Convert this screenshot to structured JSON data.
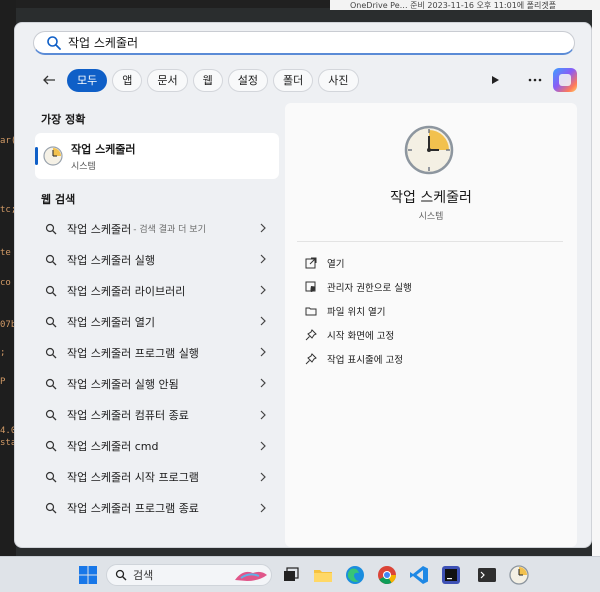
{
  "background": {
    "code_fragments": [
      "ar(",
      "tc;",
      "te",
      "co",
      "07b",
      ";",
      "P",
      "4.0",
      "sta"
    ],
    "top_right_text": "OneDrive Pe…  준비   2023-11-16 오후 11:01에   폴리겟플"
  },
  "search": {
    "query": "작업 스케줄러"
  },
  "filters": {
    "chips": [
      {
        "label": "모두",
        "active": true
      },
      {
        "label": "앱",
        "active": false
      },
      {
        "label": "문서",
        "active": false
      },
      {
        "label": "웹",
        "active": false
      },
      {
        "label": "설정",
        "active": false
      },
      {
        "label": "폴더",
        "active": false
      },
      {
        "label": "사진",
        "active": false
      }
    ]
  },
  "best_match": {
    "section_label": "가장 정확",
    "name": "작업 스케줄러",
    "type": "시스템"
  },
  "web": {
    "section_label": "웹 검색",
    "items": [
      {
        "text": "작업 스케줄러",
        "suffix": "- 검색 결과 더 보기"
      },
      {
        "text": "작업 스케줄러 실행",
        "suffix": ""
      },
      {
        "text": "작업 스케줄러 라이브러리",
        "suffix": ""
      },
      {
        "text": "작업 스케줄러 열기",
        "suffix": ""
      },
      {
        "text": "작업 스케줄러 프로그램 실행",
        "suffix": ""
      },
      {
        "text": "작업 스케줄러 실행 안됨",
        "suffix": ""
      },
      {
        "text": "작업 스케줄러 컴퓨터 종료",
        "suffix": ""
      },
      {
        "text": "작업 스케줄러 cmd",
        "suffix": ""
      },
      {
        "text": "작업 스케줄러 시작 프로그램",
        "suffix": ""
      },
      {
        "text": "작업 스케줄러 프로그램 종료",
        "suffix": ""
      }
    ]
  },
  "details": {
    "name": "작업 스케줄러",
    "type": "시스템",
    "actions": [
      {
        "label": "열기",
        "icon": "open-icon"
      },
      {
        "label": "관리자 권한으로 실행",
        "icon": "shield-icon"
      },
      {
        "label": "파일 위치 열기",
        "icon": "folder-icon"
      },
      {
        "label": "시작 화면에 고정",
        "icon": "pin-icon"
      },
      {
        "label": "작업 표시줄에 고정",
        "icon": "pin-icon"
      }
    ]
  },
  "taskbar": {
    "search_placeholder": "검색",
    "apps": [
      "task-view-icon",
      "file-explorer-icon",
      "edge-icon",
      "chrome-icon",
      "vscode-icon",
      "intellij-icon",
      "terminal-icon",
      "task-scheduler-icon"
    ]
  },
  "colors": {
    "accent": "#0f5fc7",
    "panel_bg": "#eef0f3"
  }
}
